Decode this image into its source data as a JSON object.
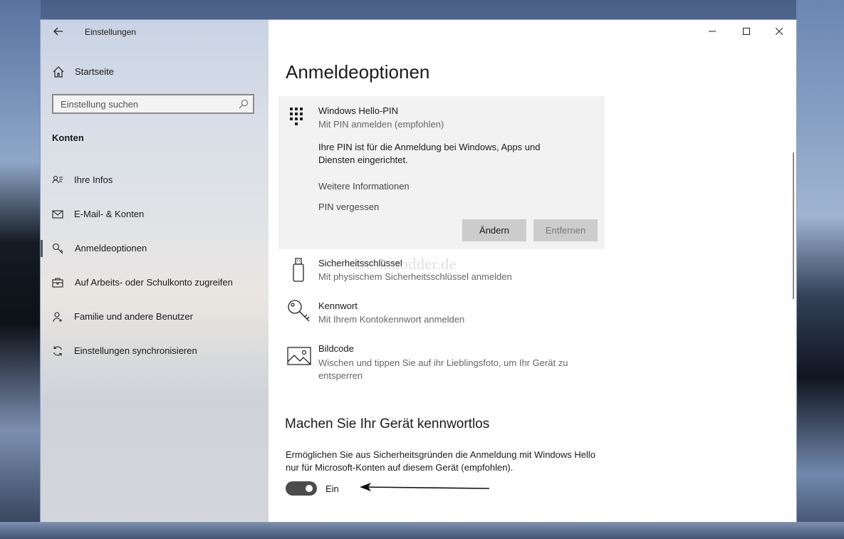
{
  "window": {
    "title": "Einstellungen"
  },
  "sidebar": {
    "home_label": "Startseite",
    "search_placeholder": "Einstellung suchen",
    "section": "Konten",
    "items": [
      {
        "label": "Ihre Infos",
        "icon": "person-card-icon"
      },
      {
        "label": "E-Mail- & Konten",
        "icon": "mail-icon"
      },
      {
        "label": "Anmeldeoptionen",
        "icon": "key-icon",
        "active": true
      },
      {
        "label": "Auf Arbeits- oder Schulkonto zugreifen",
        "icon": "briefcase-icon"
      },
      {
        "label": "Familie und andere Benutzer",
        "icon": "person-add-icon"
      },
      {
        "label": "Einstellungen synchronisieren",
        "icon": "sync-icon"
      }
    ]
  },
  "main": {
    "title": "Anmeldeoptionen",
    "pin": {
      "title": "Windows Hello-PIN",
      "subtitle": "Mit PIN anmelden (empfohlen)",
      "description": "Ihre PIN ist für die Anmeldung bei Windows, Apps und Diensten eingerichtet.",
      "link_more": "Weitere Informationen",
      "link_forgot": "PIN vergessen",
      "btn_change": "Ändern",
      "btn_remove": "Entfernen"
    },
    "options": [
      {
        "title": "Sicherheitsschlüssel",
        "subtitle": "Mit physischem Sicherheitsschlüssel anmelden",
        "icon": "usb-key-icon"
      },
      {
        "title": "Kennwort",
        "subtitle": "Mit Ihrem Kontokennwort anmelden",
        "icon": "password-key-icon"
      },
      {
        "title": "Bildcode",
        "subtitle": "Wischen und tippen Sie auf ihr Lieblingsfoto, um Ihr Gerät zu entsperren",
        "icon": "picture-icon"
      }
    ],
    "passwordless": {
      "heading": "Machen Sie Ihr Gerät kennwortlos",
      "description": "Ermöglichen Sie aus Sicherheitsgründen die Anmeldung mit Windows Hello nur für Microsoft-Konten auf diesem Gerät (empfohlen).",
      "toggle_state": "on",
      "toggle_label": "Ein"
    },
    "watermark": "Deskmodder.de"
  },
  "colors": {
    "toggle_on": "#4c4c4c",
    "card_bg": "#f2f2f2",
    "button_bg": "#cccccc"
  }
}
